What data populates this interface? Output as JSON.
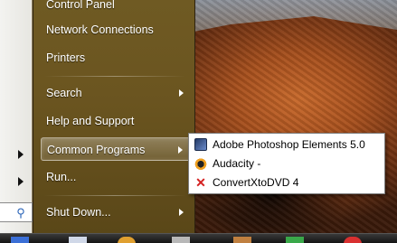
{
  "start_menu": {
    "items": [
      {
        "label": "Control Panel",
        "has_arrow": false
      },
      {
        "label": "Network Connections",
        "has_arrow": false
      },
      {
        "label": "Printers",
        "has_arrow": false
      },
      {
        "label": "Search",
        "has_arrow": true
      },
      {
        "label": "Help and Support",
        "has_arrow": false
      },
      {
        "label": "Common Programs",
        "has_arrow": true,
        "selected": true
      },
      {
        "label": "Run...",
        "has_arrow": false
      },
      {
        "label": "Shut Down...",
        "has_arrow": true
      }
    ]
  },
  "submenu": {
    "items": [
      {
        "label": "Adobe Photoshop Elements 5.0",
        "icon": "photoshop-icon"
      },
      {
        "label": "Audacity -",
        "icon": "audacity-icon"
      },
      {
        "label": "ConvertXtoDVD 4",
        "icon": "convertxtodvd-icon"
      }
    ]
  },
  "colors": {
    "menu_bg": "#6b5520",
    "submenu_bg": "#ffffff",
    "text_light": "#ffffff"
  }
}
